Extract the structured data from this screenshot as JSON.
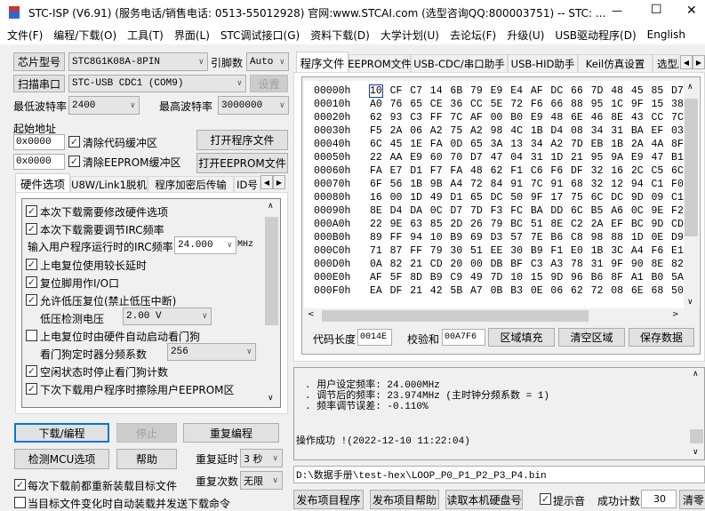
{
  "title": "STC-ISP (V6.91) (服务电话/销售电话: 0513-55012928) 官网:www.STCAI.com  (选型咨询QQ:800003751) -- STC: ...",
  "window_controls": {
    "minimize": "—",
    "maximize": "☐",
    "close": "✕"
  },
  "menu": [
    "文件(F)",
    "编程/下载(O)",
    "工具(T)",
    "界面(L)",
    "STC调试接口(G)",
    "资料下载(D)",
    "大学计划(U)",
    "去论坛(F)",
    "升级(U)",
    "USB驱动程序(D)",
    "English"
  ],
  "left": {
    "chip_button": "芯片型号",
    "chip_value": "STC8G1K08A-8PIN",
    "pins_label": "引脚数",
    "pins_value": "Auto",
    "scan_button": "扫描串口",
    "port_value": "STC-USB CDC1 (COM9)",
    "settings_button": "设置",
    "min_baud_label": "最低波特率",
    "min_baud_value": "2400",
    "max_baud_label": "最高波特率",
    "max_baud_value": "3000000",
    "start_addr_label": "起始地址",
    "addr1": "0x0000",
    "clear_code": "清除代码缓冲区",
    "addr2": "0x0000",
    "clear_eeprom": "清除EEPROM缓冲区",
    "open_program": "打开程序文件",
    "open_eeprom": "打开EEPROM文件",
    "tabs": [
      "硬件选项",
      "U8W/Link1脱机",
      "程序加密后传输",
      "ID号"
    ],
    "options": {
      "opt1": "本次下载需要修改硬件选项",
      "opt2": "本次下载需要调节IRC频率",
      "irc_label": "输入用户程序运行时的IRC频率",
      "irc_value": "24.000",
      "irc_unit": "MHz",
      "opt3": "上电复位使用较长延时",
      "opt4": "复位脚用作I/O口",
      "opt5": "允许低压复位(禁止低压中断)",
      "lv_label": "低压检测电压",
      "lv_value": "2.00 V",
      "opt6": "上电复位时由硬件自动启动看门狗",
      "wdt_label": "看门狗定时器分频系数",
      "wdt_value": "256",
      "opt7": "空闲状态时停止看门狗计数",
      "opt8": "下次下载用户程序时擦除用户EEPROM区"
    },
    "download_button": "下载/编程",
    "stop_button": "停止",
    "repeat_button": "重复编程",
    "detect_button": "检测MCU选项",
    "help_button": "帮助",
    "repeat_delay_label": "重复延时",
    "repeat_delay_value": "3 秒",
    "repeat_count_label": "重复次数",
    "repeat_count_value": "无限",
    "reload_check": "每次下载前都重新装载目标文件",
    "auto_check": "当目标文件变化时自动装载并发送下载命令"
  },
  "right": {
    "tabs": [
      "程序文件",
      "EEPROM文件",
      "USB-CDC/串口助手",
      "USB-HID助手",
      "Keil仿真设置",
      "选型/"
    ],
    "hex": [
      {
        "addr": "00000h",
        "bytes": "10 CF C7 14 6B 79 E9 E4 AF DC 66 7D 48 45 85 D7"
      },
      {
        "addr": "00010h",
        "bytes": "A0 76 65 CE 36 CC 5E 72 F6 66 88 95 1C 9F 15 38"
      },
      {
        "addr": "00020h",
        "bytes": "62 93 C3 FF 7C AF 00 B0 E9 48 6E 46 8E 43 CC 7C"
      },
      {
        "addr": "00030h",
        "bytes": "F5 2A 06 A2 75 A2 98 4C 1B D4 08 34 31 BA EF 03"
      },
      {
        "addr": "00040h",
        "bytes": "6C 45 1E FA 0D 65 3A 13 34 A2 7D EB 1B 2A 4A 8F"
      },
      {
        "addr": "00050h",
        "bytes": "22 AA E9 60 70 D7 47 04 31 1D 21 95 9A E9 47 B1"
      },
      {
        "addr": "00060h",
        "bytes": "FA E7 D1 F7 FA 48 62 F1 C6 F6 DF 32 16 2C C5 6C"
      },
      {
        "addr": "00070h",
        "bytes": "6F 56 1B 9B A4 72 84 91 7C 91 68 32 12 94 C1 F0"
      },
      {
        "addr": "00080h",
        "bytes": "16 00 1D 49 D1 65 DC 50 9F 17 75 6C DC 9D 09 C1"
      },
      {
        "addr": "00090h",
        "bytes": "8E D4 DA 0C D7 7D F3 FC BA DD 6C B5 A6 0C 9E F2"
      },
      {
        "addr": "000A0h",
        "bytes": "22 9E 63 85 2D 26 79 BC 51 8E C2 2A EF BC 9D CD"
      },
      {
        "addr": "000B0h",
        "bytes": "89 FF 94 10 B9 69 D3 57 7E B6 C8 98 88 1D 0E D9"
      },
      {
        "addr": "000C0h",
        "bytes": "71 87 FF 79 30 51 EE 30 B9 F1 E0 1B 3C A4 F6 E1"
      },
      {
        "addr": "000D0h",
        "bytes": "0A 82 21 CD 20 00 DB BF C3 A3 78 31 9F 90 8E 82"
      },
      {
        "addr": "000E0h",
        "bytes": "AF 5F 8D B9 C9 49 7D 10 15 9D 96 B6 8F A1 B0 5A"
      },
      {
        "addr": "000F0h",
        "bytes": "EA DF 21 42 5B A7 0B B3 0E 06 62 72 08 6E 68 50"
      }
    ],
    "code_len_label": "代码长度",
    "code_len": "0014E",
    "checksum_label": "校验和",
    "checksum": "00A7F6",
    "fill_button": "区域填充",
    "clear_button": "清空区域",
    "save_button": "保存数据",
    "log": [
      ". 用户设定频率: 24.000MHz",
      ". 调节后的频率: 23.974MHz (主时钟分频系数 = 1)",
      ". 频率调节误差: -0.110%"
    ],
    "log_success": "操作成功 !(2022-12-10 11:22:04)",
    "path": "D:\\数据手册\\test-hex\\LOOP_P0_P1_P2_P3_P4.bin",
    "publish_program": "发布项目程序",
    "publish_help": "发布项目帮助",
    "read_disk": "读取本机硬盘号",
    "sound_check": "提示音",
    "success_count_label": "成功计数",
    "success_count": "30",
    "clear_count": "清零"
  }
}
